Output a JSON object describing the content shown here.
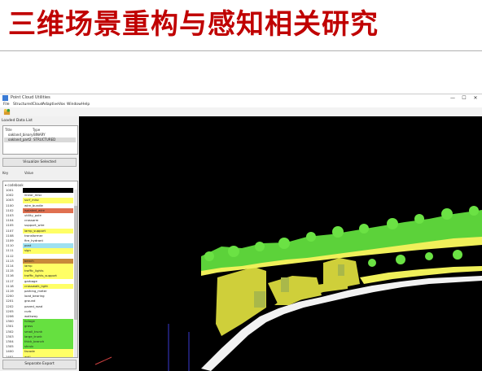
{
  "slide": {
    "title": "三维场景重构与感知相关研究"
  },
  "window": {
    "title": "Point Cloud Utilities",
    "controls": {
      "minimize": "—",
      "maximize": "☐",
      "close": "✕"
    },
    "menu": [
      "File",
      "StructuredCloud",
      "AdaptiveVox",
      "Window",
      "Help"
    ],
    "toolbar_icon": "cloud-tool-icon"
  },
  "left_panel": {
    "loaded_header": "Loaded Data List",
    "columns": {
      "title": "Title",
      "type": "Type"
    },
    "loaded": [
      {
        "title": "oakland_binary",
        "type": "BINARY"
      },
      {
        "title": "oakland_part2",
        "type": "STRUCTURED"
      }
    ],
    "visualize_button": "Visualize Selected",
    "codebook_columns": {
      "key": "Key",
      "value": "Value"
    },
    "codebook_root": "codebook",
    "codebook": [
      {
        "key": "1001",
        "value": "",
        "color": "#000000"
      },
      {
        "key": "1002",
        "value": "linear_misc",
        "color": "#ffffff"
      },
      {
        "key": "1003",
        "value": "surf_misc",
        "color": "#ffff66"
      },
      {
        "key": "1100",
        "value": "wire_bundle",
        "color": "#ffffff"
      },
      {
        "key": "1102",
        "value": "isolated_wire",
        "color": "#e07050"
      },
      {
        "key": "1103",
        "value": "utility_pole",
        "color": "#ffffff"
      },
      {
        "key": "1104",
        "value": "crossarm",
        "color": "#ffffff"
      },
      {
        "key": "1105",
        "value": "support_wire",
        "color": "#ffffff"
      },
      {
        "key": "1107",
        "value": "lamp_support",
        "color": "#ffff66"
      },
      {
        "key": "1108",
        "value": "transformer",
        "color": "#ffffff"
      },
      {
        "key": "1109",
        "value": "fire_hydrant",
        "color": "#ffffff"
      },
      {
        "key": "1110",
        "value": "post",
        "color": "#9ee0f0"
      },
      {
        "key": "1111",
        "value": "sign",
        "color": "#ffff66"
      },
      {
        "key": "1112",
        "value": "",
        "color": "#ffffff"
      },
      {
        "key": "1113",
        "value": "bench",
        "color": "#c98a3a"
      },
      {
        "key": "1114",
        "value": "lamp",
        "color": "#ffff66"
      },
      {
        "key": "1115",
        "value": "traffic_lights",
        "color": "#ffff66"
      },
      {
        "key": "1116",
        "value": "traffic_lights_support",
        "color": "#ffff66"
      },
      {
        "key": "1117",
        "value": "garbage",
        "color": "#ffffff"
      },
      {
        "key": "1118",
        "value": "crosswalk_light",
        "color": "#ffff66"
      },
      {
        "key": "1119",
        "value": "parking_meter",
        "color": "#ffffff"
      },
      {
        "key": "1200",
        "value": "load_bearing",
        "color": "#ffffff"
      },
      {
        "key": "1201",
        "value": "ground",
        "color": "#ffffff"
      },
      {
        "key": "1202",
        "value": "paved_road",
        "color": "#ffffff"
      },
      {
        "key": "1205",
        "value": "curb",
        "color": "#ffffff"
      },
      {
        "key": "1206",
        "value": "walkway",
        "color": "#ffffff"
      },
      {
        "key": "1300",
        "value": "foliage",
        "color": "#66e040"
      },
      {
        "key": "1301",
        "value": "grass",
        "color": "#66e040"
      },
      {
        "key": "1302",
        "value": "small_trunk",
        "color": "#66e040"
      },
      {
        "key": "1303",
        "value": "large_trunk",
        "color": "#66e040"
      },
      {
        "key": "1304",
        "value": "thick_branch",
        "color": "#66e040"
      },
      {
        "key": "1305",
        "value": "shrub",
        "color": "#66e040"
      },
      {
        "key": "1400",
        "value": "facade",
        "color": "#ffff66"
      },
      {
        "key": "1401",
        "value": "wall",
        "color": "#ffff66"
      }
    ],
    "separate_button": "Separate Export"
  }
}
